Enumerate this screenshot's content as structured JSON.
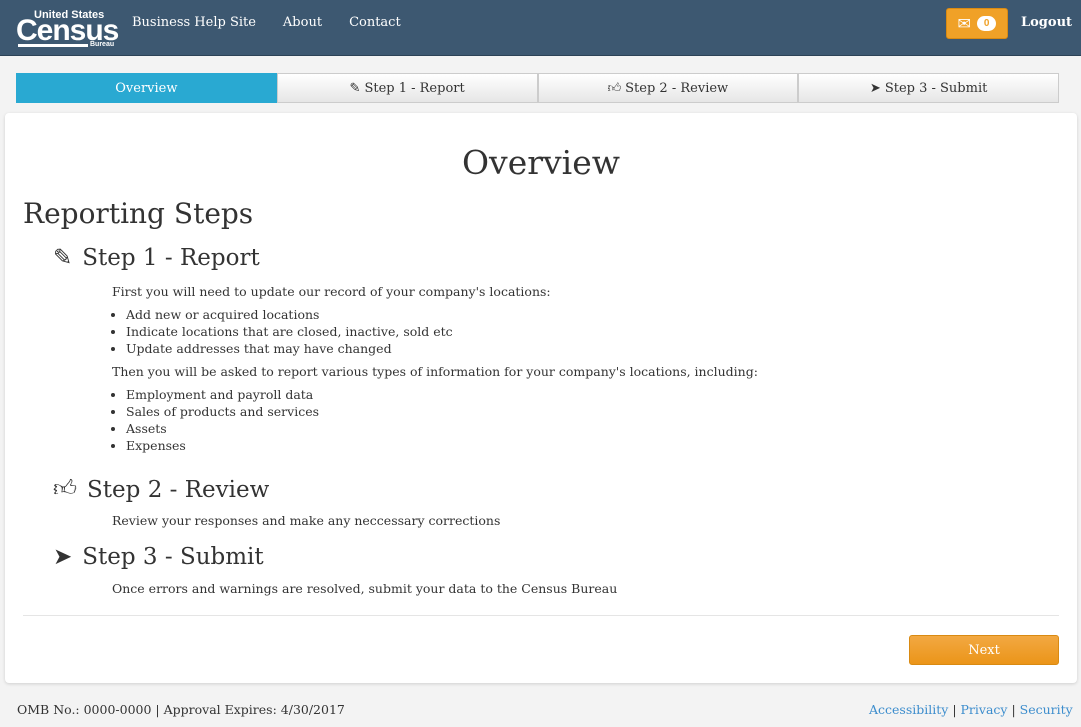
{
  "header": {
    "logo_top": "United States",
    "logo_main": "Census",
    "logo_bottom": "Bureau",
    "links": [
      "Business Help Site",
      "About",
      "Contact"
    ],
    "message_count": "0",
    "logout": "Logout"
  },
  "tabs": [
    "Overview",
    "Step 1 - Report",
    "Step 2 - Review",
    "Step 3 - Submit"
  ],
  "main": {
    "title": "Overview",
    "subtitle": "Reporting Steps",
    "step1": {
      "title": "Step 1 - Report",
      "intro": "First you will need to update our record of your company's locations:",
      "list1": [
        "Add new or acquired locations",
        "Indicate locations that are closed, inactive, sold etc",
        "Update addresses that may have changed"
      ],
      "intro2": "Then you will be asked to report various types of information for your company's locations, including:",
      "list2": [
        "Employment and payroll data",
        "Sales of products and services",
        "Assets",
        "Expenses"
      ]
    },
    "step2": {
      "title": "Step 2 - Review",
      "text": "Review your responses and make any neccessary corrections"
    },
    "step3": {
      "title": "Step 3 - Submit",
      "text": "Once errors and warnings are resolved, submit your data to the Census Bureau"
    },
    "next": "Next"
  },
  "footer": {
    "omb": "OMB No.: 0000-0000  |  Approval Expires: 4/30/2017",
    "links": [
      "Accessibility",
      "Privacy",
      "Security"
    ]
  }
}
